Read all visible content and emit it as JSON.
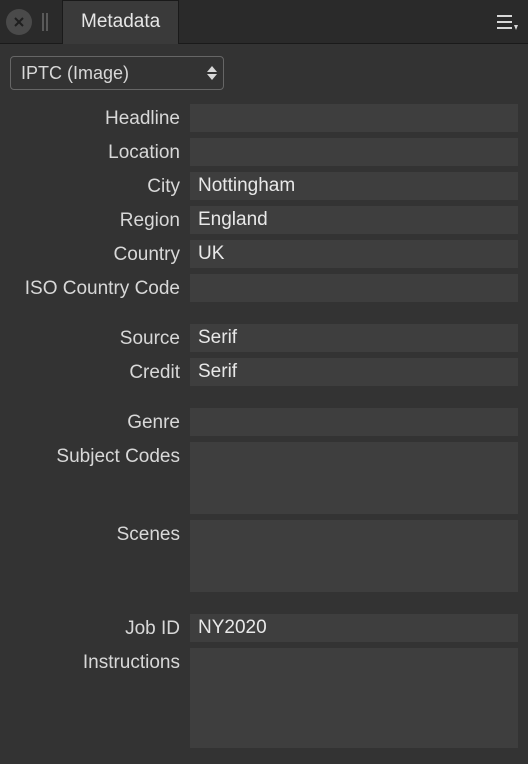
{
  "panel": {
    "tab_label": "Metadata",
    "dropdown_selected": "IPTC (Image)"
  },
  "fields": {
    "headline_label": "Headline",
    "headline_value": "",
    "location_label": "Location",
    "location_value": "",
    "city_label": "City",
    "city_value": "Nottingham",
    "region_label": "Region",
    "region_value": "England",
    "country_label": "Country",
    "country_value": "UK",
    "iso_label": "ISO Country Code",
    "iso_value": "",
    "source_label": "Source",
    "source_value": "Serif",
    "credit_label": "Credit",
    "credit_value": "Serif",
    "genre_label": "Genre",
    "genre_value": "",
    "subject_codes_label": "Subject Codes",
    "subject_codes_value": "",
    "scenes_label": "Scenes",
    "scenes_value": "",
    "jobid_label": "Job ID",
    "jobid_value": "NY2020",
    "instructions_label": "Instructions",
    "instructions_value": ""
  }
}
